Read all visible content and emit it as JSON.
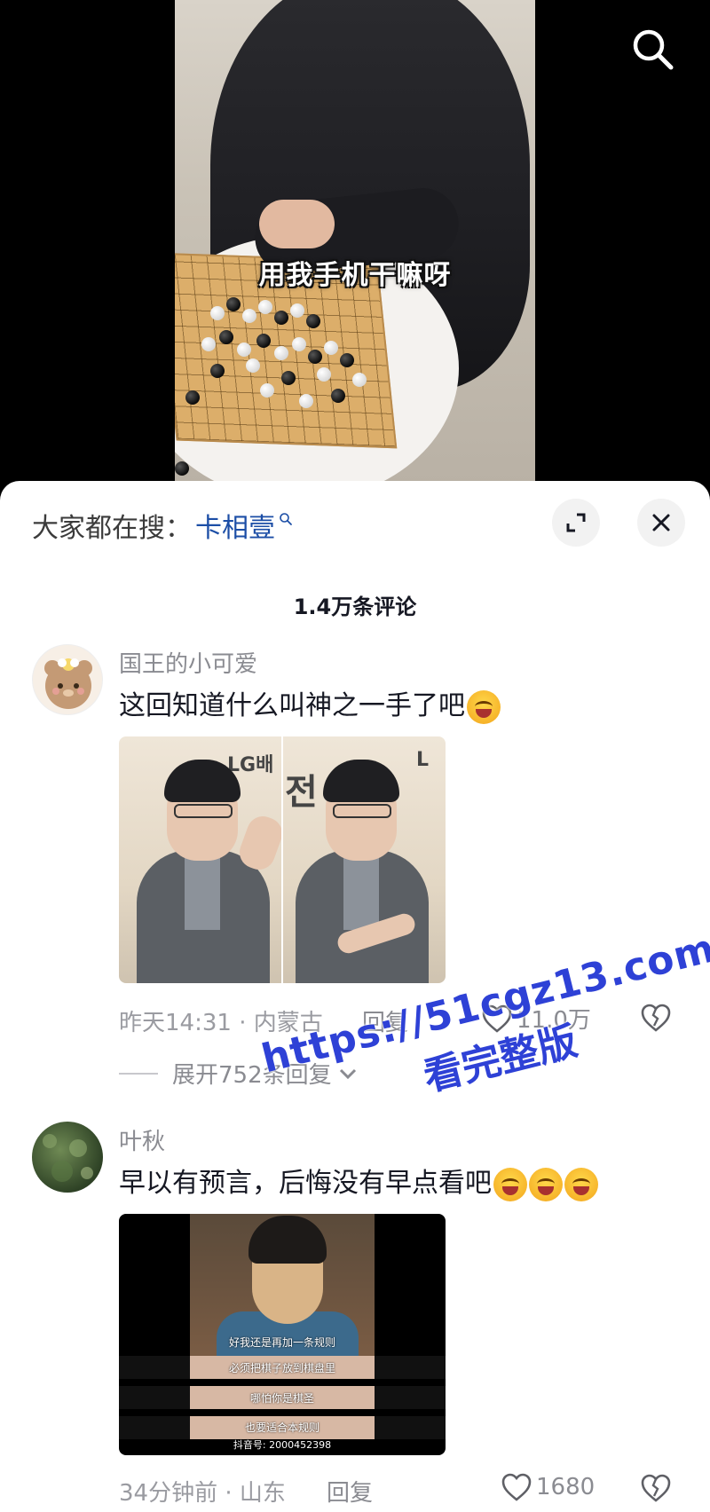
{
  "video": {
    "caption": "用我手机干嘛呀",
    "search_icon": "search-icon"
  },
  "panel": {
    "search_prefix": "大家都在搜：",
    "search_keyword": "卡相壹",
    "expand_icon": "expand-icon",
    "close_icon": "close-icon",
    "comment_count": "1.4万条评论"
  },
  "comments": [
    {
      "username": "国王的小可爱",
      "text": "这回知道什么叫神之一手了吧",
      "emojis": [
        "crying-laugh-emoji"
      ],
      "image_sign_left": "LG배",
      "image_sign_right": "전",
      "meta": "昨天14:31 · 内蒙古",
      "reply_label": "回复",
      "likes": "11.0万",
      "expand_replies": "展开752条回复"
    },
    {
      "username": "叶秋",
      "text": "早以有预言，后悔没有早点看吧",
      "emojis": [
        "rolling-laugh-emoji",
        "rolling-laugh-emoji",
        "rolling-laugh-emoji"
      ],
      "subtitles": [
        "好我还是再加一条规则",
        "必须把棋子放到棋盘里",
        "哪怕你是棋圣",
        "也要适合本规则"
      ],
      "video_id": "抖音号: 2000452398",
      "meta": "34分钟前 · 山东",
      "reply_label": "回复",
      "likes": "1680"
    }
  ],
  "watermark": {
    "url": "https://51cgz13.com",
    "text": "看完整版"
  },
  "colors": {
    "keyword": "#1c4ea6",
    "watermark": "#2e41d6"
  }
}
